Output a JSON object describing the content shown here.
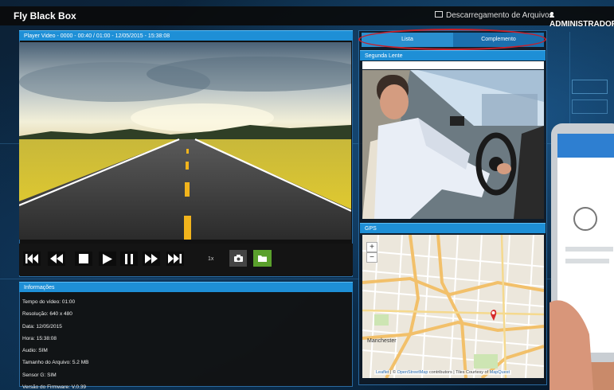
{
  "app": {
    "title": "Fly Black Box",
    "downloads_label": "Descarregamento de Arquivos",
    "admin_label": "ADMINISTRADOR"
  },
  "video": {
    "header": "Player Video - 0000 - 00:40 / 01:00 - 12/05/2015 - 15:38:08",
    "speed": "1x",
    "controls": [
      "skip-start",
      "rewind",
      "stop",
      "play",
      "pause",
      "fast-forward",
      "skip-end"
    ]
  },
  "info": {
    "header": "Informações",
    "items": [
      "Tempo do vídeo: 01:00",
      "Resolução: 640 x 480",
      "Data: 12/05/2015",
      "Hora: 15:38:08",
      "Audio: SIM",
      "Tamanho do Arquivo: 5.2 MB",
      "Sensor G: SIM",
      "Versão do Firmware: V.0.39"
    ]
  },
  "tabs": {
    "lista": "Lista",
    "complemento": "Complemento"
  },
  "lens": {
    "header": "Segunda Lente"
  },
  "gps": {
    "header": "GPS",
    "zoom_in": "+",
    "zoom_out": "−",
    "city_label": "Manchester",
    "attribution": {
      "leaflet": "Leaflet",
      "osm": "OpenStreetMap",
      "contributors": "contributors | Tiles Courtesy of",
      "mapquest": "MapQuest"
    }
  },
  "colors": {
    "accent": "#1e8fd6",
    "highlight": "#c8202a",
    "folder_button": "#5aa02c"
  }
}
